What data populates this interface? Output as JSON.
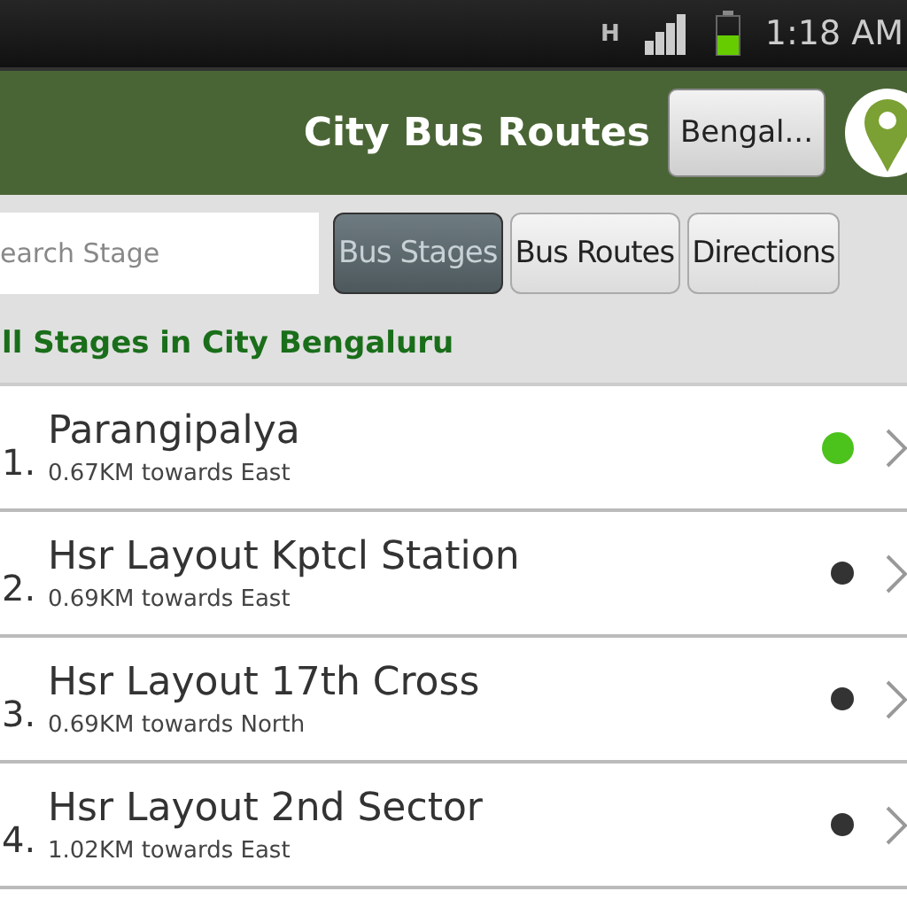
{
  "status_bar": {
    "network": "H",
    "time": "1:18 AM"
  },
  "app_bar": {
    "title": "City Bus Routes",
    "city_button": "Bengal..."
  },
  "search": {
    "placeholder": "earch Stage"
  },
  "tabs": [
    {
      "label": "Bus Stages",
      "selected": true
    },
    {
      "label": "Bus Routes",
      "selected": false
    },
    {
      "label": "Directions",
      "selected": false
    }
  ],
  "list_header": "ll Stages in City Bengaluru",
  "stages": [
    {
      "number": "1.",
      "name": "Parangipalya",
      "distance": "0.67KM towards East",
      "color": "#4cc21c"
    },
    {
      "number": "2.",
      "name": "Hsr Layout Kptcl Station",
      "distance": "0.69KM towards East",
      "color": "#333333"
    },
    {
      "number": "3.",
      "name": "Hsr Layout 17th Cross",
      "distance": "0.69KM towards North",
      "color": "#333333"
    },
    {
      "number": "4.",
      "name": "Hsr Layout 2nd Sector",
      "distance": "1.02KM towards East",
      "color": "#333333"
    }
  ]
}
